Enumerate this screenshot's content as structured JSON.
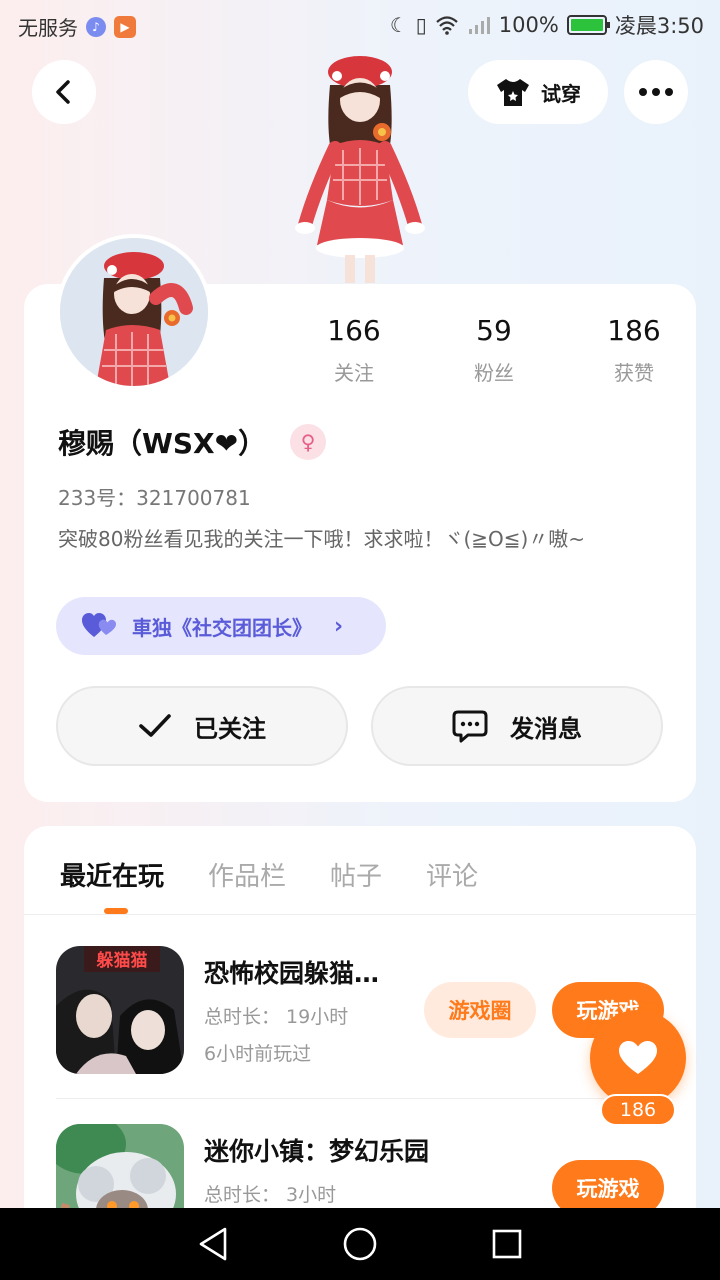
{
  "status_bar": {
    "carrier": "无服务",
    "battery_percent": "100%",
    "time": "凌晨3:50",
    "battery_color": "#2cc23c"
  },
  "header": {
    "try_on_label": "试穿",
    "back_icon": "chevron-left-icon",
    "more_icon": "more-dots-icon"
  },
  "profile": {
    "stats": [
      {
        "value": "166",
        "label": "关注"
      },
      {
        "value": "59",
        "label": "粉丝"
      },
      {
        "value": "186",
        "label": "获赞"
      }
    ],
    "nickname": "穆赐（WSX❤）",
    "gender_symbol": "♀",
    "uid": "233号：321700781",
    "bio": "突破80粉丝看见我的关注一下哦！求求啦！ヾ(≧O≦)〃嗷~",
    "group_badge": "車独《社交团团长》",
    "follow_label": "已关注",
    "message_label": "发消息"
  },
  "tabs": [
    {
      "label": "最近在玩",
      "active": true
    },
    {
      "label": "作品栏",
      "active": false
    },
    {
      "label": "帖子",
      "active": false
    },
    {
      "label": "评论",
      "active": false
    }
  ],
  "games": [
    {
      "title": "恐怖校园躲猫…",
      "duration": "总时长： 19小时",
      "last_played": "6小时前玩过",
      "circle_label": "游戏圈",
      "play_label": "玩游戏",
      "icon_text": "躲猫猫"
    },
    {
      "title": "迷你小镇：梦幻乐园",
      "duration": "总时长： 3小时",
      "play_label": "玩游戏"
    }
  ],
  "like": {
    "count": "186"
  },
  "colors": {
    "accent": "#ff7a1a",
    "badge_bg": "#e5e6fd",
    "badge_text": "#5a5bd8",
    "gender": "#e65f87"
  }
}
